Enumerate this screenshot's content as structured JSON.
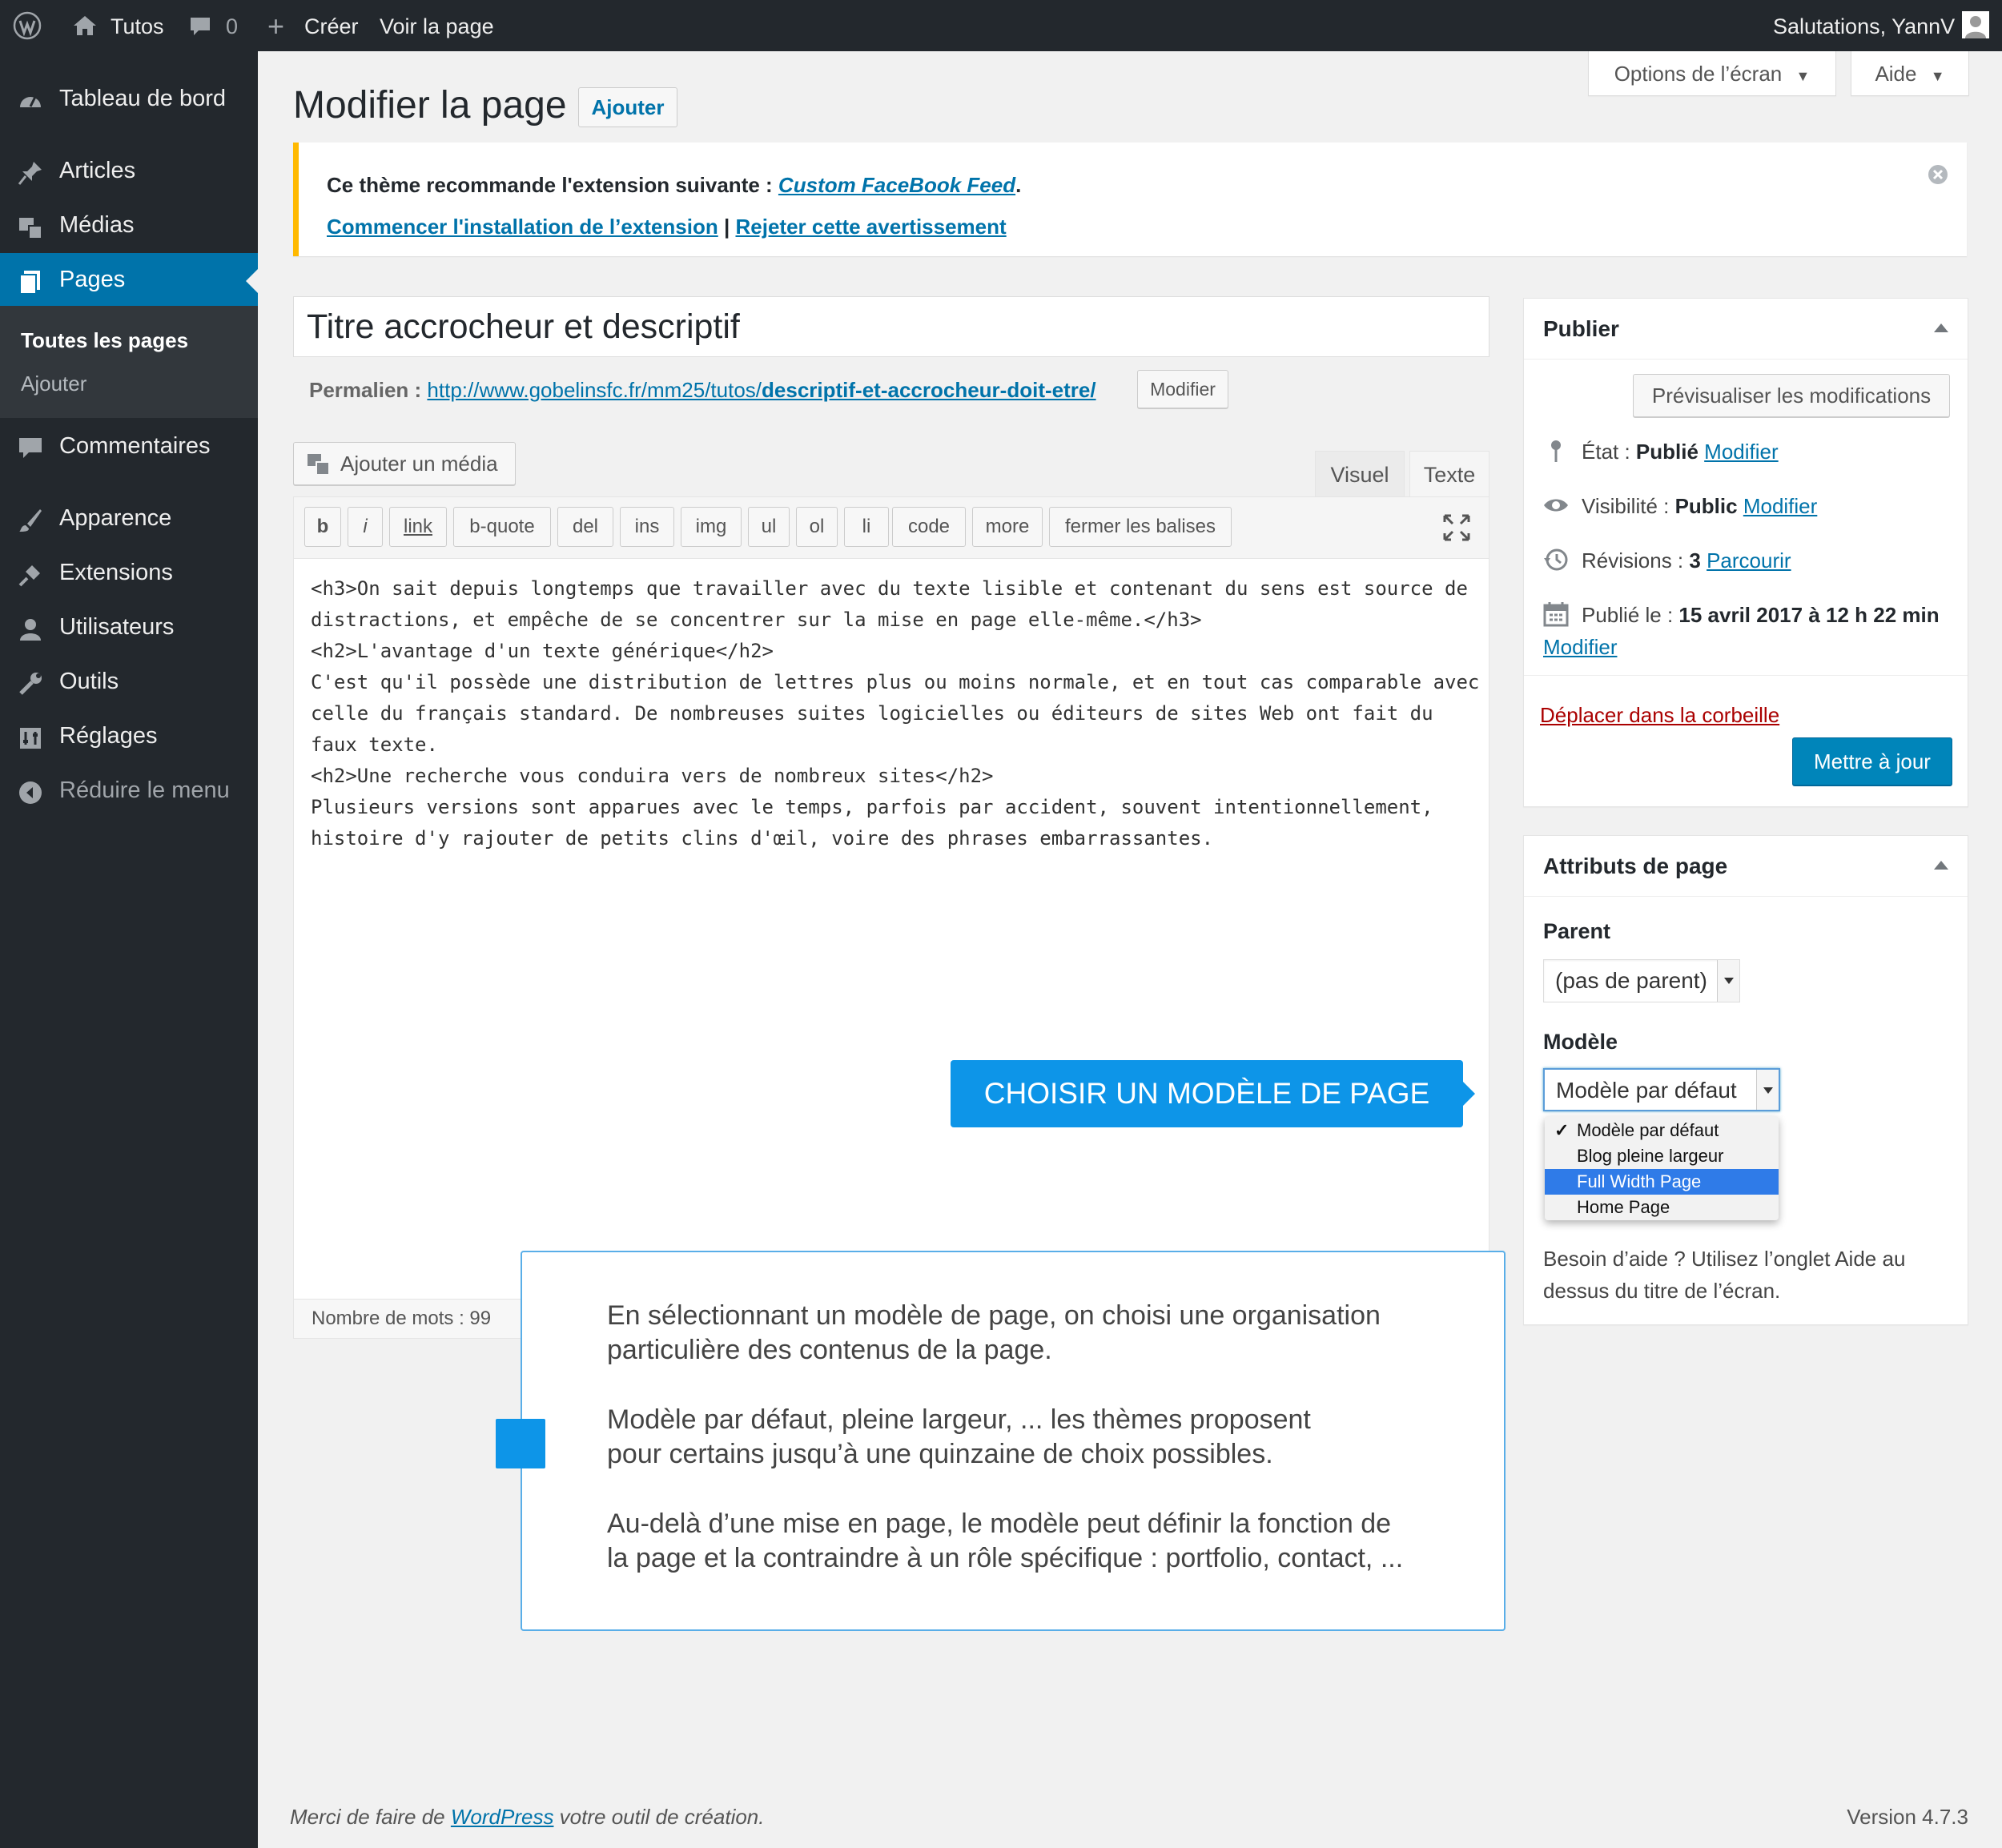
{
  "adminbar": {
    "site_name": "Tutos",
    "comments_count": "0",
    "new_label": "Créer",
    "view_page": "Voir la page",
    "greeting": "Salutations, YannV"
  },
  "sidebar": {
    "items": [
      {
        "label": "Tableau de bord",
        "icon": "dashboard-icon"
      },
      {
        "label": "Articles",
        "icon": "pin-icon"
      },
      {
        "label": "Médias",
        "icon": "media-icon"
      },
      {
        "label": "Pages",
        "icon": "pages-icon"
      },
      {
        "label": "Commentaires",
        "icon": "comments-icon"
      },
      {
        "label": "Apparence",
        "icon": "appearance-icon"
      },
      {
        "label": "Extensions",
        "icon": "plugins-icon"
      },
      {
        "label": "Utilisateurs",
        "icon": "users-icon"
      },
      {
        "label": "Outils",
        "icon": "tools-icon"
      },
      {
        "label": "Réglages",
        "icon": "settings-icon"
      },
      {
        "label": "Réduire le menu",
        "icon": "collapse-icon"
      }
    ],
    "submenu": [
      "Toutes les pages",
      "Ajouter"
    ]
  },
  "header": {
    "title": "Modifier la page",
    "add_new": "Ajouter",
    "screen_options": "Options de l’écran",
    "help": "Aide"
  },
  "notice": {
    "text": "Ce thème recommande l'extension suivante : ",
    "plugin": "Custom FaceBook Feed",
    "period": ".",
    "install": "Commencer l'installation de l’extension",
    "sep": " | ",
    "dismiss": "Rejeter cette avertissement"
  },
  "post": {
    "title": "Titre accrocheur et descriptif",
    "permalink_label": "Permalien : ",
    "permalink_base": "http://www.gobelinsfc.fr/mm25/tutos/",
    "permalink_slug": "descriptif-et-accrocheur-doit-etre/",
    "permalink_edit": "Modifier"
  },
  "editor": {
    "add_media": "Ajouter un média",
    "tab_visual": "Visuel",
    "tab_text": "Texte",
    "buttons": [
      "b",
      "i",
      "link",
      "b-quote",
      "del",
      "ins",
      "img",
      "ul",
      "ol",
      "li",
      "code",
      "more",
      "fermer les balises"
    ],
    "lines": [
      "<h3>On sait depuis longtemps que travailler avec du texte lisible et contenant du sens est source de",
      "distractions, et empêche de se concentrer sur la mise en page elle-même.</h3>",
      "<h2>L'avantage d'un texte générique</h2>",
      "C'est qu'il possède une distribution de lettres plus ou moins normale, et en tout cas comparable avec",
      "celle du français standard. De nombreuses suites logicielles ou éditeurs de sites Web ont fait du",
      "faux texte.",
      "<h2>Une recherche vous conduira vers de nombreux sites</h2>",
      "Plusieurs versions sont apparues avec le temps, parfois par accident, souvent intentionnellement,",
      "histoire d'y rajouter de petits clins d'œil, voire des phrases embarrassantes."
    ],
    "word_count": "Nombre de mots : 99"
  },
  "publish": {
    "title": "Publier",
    "preview": "Prévisualiser les modifications",
    "status_label": "État : ",
    "status_value": "Publié",
    "visibility_label": "Visibilité : ",
    "visibility_value": "Public",
    "revisions_label": "Révisions : ",
    "revisions_value": "3",
    "browse": "Parcourir",
    "published_label": "Publié le : ",
    "published_value": "15 avril 2017 à 12 h 22 min",
    "edit": "Modifier",
    "trash": "Déplacer dans la corbeille",
    "update": "Mettre à jour"
  },
  "attributes": {
    "title": "Attributs de page",
    "parent_label": "Parent",
    "parent_value": "(pas de parent)",
    "template_label": "Modèle",
    "template_value": "Modèle par défaut",
    "options": [
      "Modèle par défaut",
      "Blog pleine largeur",
      "Full Width Page",
      "Home Page"
    ],
    "checkmark": "✓",
    "help_line1": "Besoin d’aide ? Utilisez l’onglet Aide au",
    "help_line2": "dessus du titre de l’écran."
  },
  "callout": {
    "label": "CHOISIR UN MODÈLE DE PAGE",
    "p1_l1": "En sélectionnant un modèle de page, on choisi une organisation",
    "p1_l2": "particulière des contenus de la page.",
    "p2_l1": "Modèle par défaut, pleine largeur, ... les thèmes proposent",
    "p2_l2": "pour certains jusqu’à une quinzaine de choix possibles.",
    "p3_l1": "Au-delà d’une mise en page, le modèle peut définir la fonction de",
    "p3_l2": "la page et la contraindre à un rôle spécifique : portfolio, contact, ..."
  },
  "footer": {
    "left_pre": "Merci de faire de ",
    "left_link": "WordPress",
    "left_post": " votre outil de création.",
    "version": "Version 4.7.3"
  },
  "colors": {
    "adminbar": "#23282d",
    "accent": "#0073aa",
    "primary_button": "#0085ba",
    "callout": "#0d95e8",
    "notice_border": "#ffb900",
    "trash": "#a00"
  }
}
